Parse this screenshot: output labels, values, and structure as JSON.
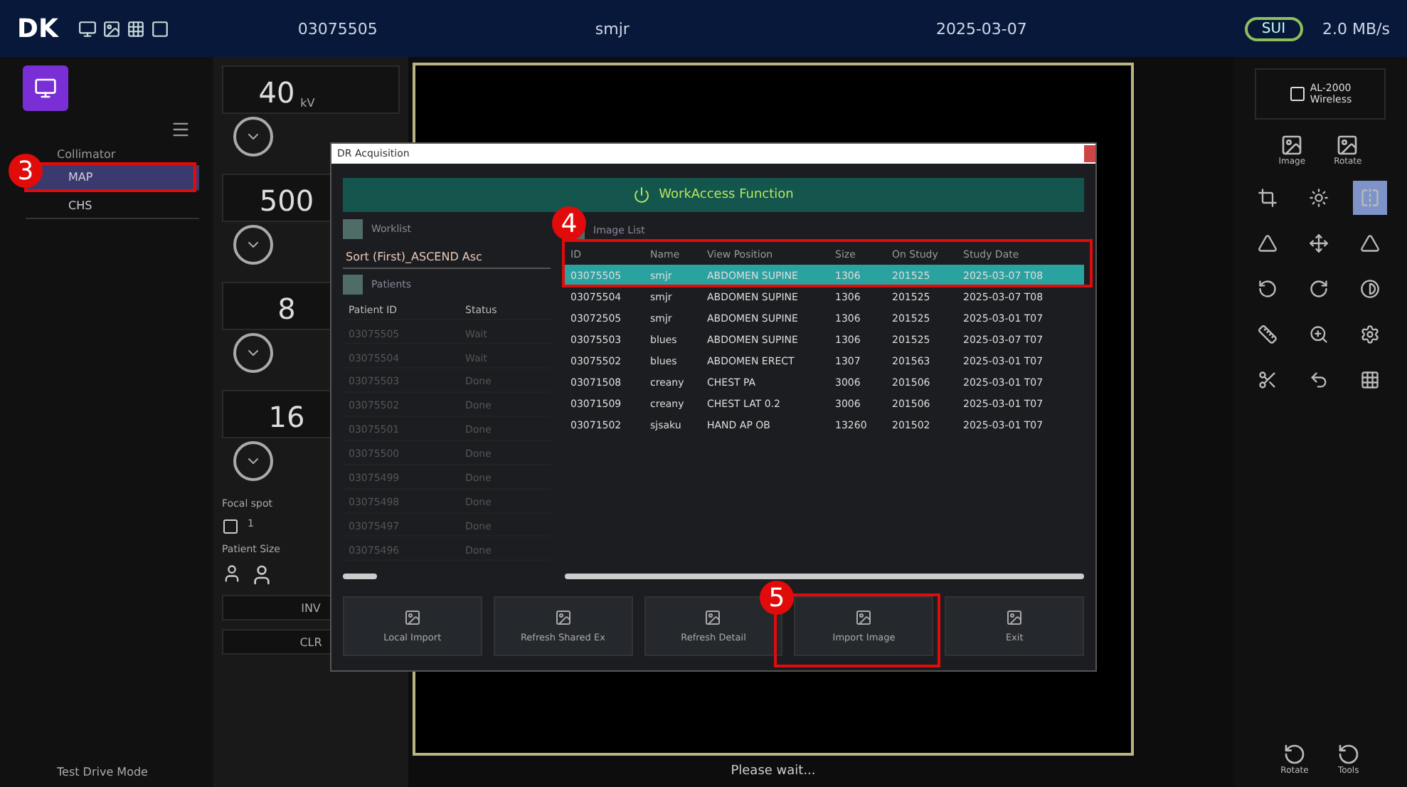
{
  "header": {
    "logo": "DK",
    "patient_id": "03075505",
    "patient_name": "smjr",
    "study_date": "2025-03-07",
    "mode_badge": "SUI",
    "status": "2.0 MB/s"
  },
  "sidebar": {
    "section_label": "Collimator",
    "items": [
      {
        "label": "MAP",
        "selected": true
      },
      {
        "label": "CHS",
        "selected": false
      }
    ],
    "footer": "Test Drive Mode"
  },
  "parameters": [
    {
      "value": "40",
      "unit": "kV"
    },
    {
      "value": "500"
    },
    {
      "value": "8"
    },
    {
      "value": "16"
    }
  ],
  "focal_spot": {
    "label": "Focal spot",
    "value": "1"
  },
  "patient_size": {
    "label": "Patient Size"
  },
  "lower_fields": [
    "INV",
    "CLR"
  ],
  "dialog": {
    "title": "DR Acquisition",
    "banner": "WorkAccess Function",
    "sort_label": "Worklist",
    "sort_value": "Sort (First)_ASCEND Asc",
    "patients_label": "Patients",
    "patient_columns": [
      "Patient ID",
      "Status"
    ],
    "patients": [
      {
        "id": "03075505",
        "status": "Wait"
      },
      {
        "id": "03075504",
        "status": "Wait"
      },
      {
        "id": "03075503",
        "status": "Done"
      },
      {
        "id": "03075502",
        "status": "Done"
      },
      {
        "id": "03075501",
        "status": "Done"
      },
      {
        "id": "03075500",
        "status": "Done"
      },
      {
        "id": "03075499",
        "status": "Done"
      },
      {
        "id": "03075498",
        "status": "Done"
      },
      {
        "id": "03075497",
        "status": "Done"
      },
      {
        "id": "03075496",
        "status": "Done"
      }
    ],
    "images_label": "Image List",
    "image_columns": [
      "ID",
      "Name",
      "View Position",
      "Size",
      "On Study",
      "Study Date"
    ],
    "images": [
      {
        "cells": [
          "03075505",
          "smjr",
          "ABDOMEN SUPINE",
          "1306",
          "201525",
          "2025-03-07 T08"
        ],
        "selected": true
      },
      {
        "cells": [
          "03075504",
          "smjr",
          "ABDOMEN SUPINE",
          "1306",
          "201525",
          "2025-03-07 T08"
        ],
        "selected": false
      },
      {
        "cells": [
          "03072505",
          "smjr",
          "ABDOMEN SUPINE",
          "1306",
          "201525",
          "2025-03-01 T07"
        ],
        "selected": false
      },
      {
        "cells": [
          "03075503",
          "blues",
          "ABDOMEN SUPINE",
          "1306",
          "201525",
          "2025-03-07 T07"
        ],
        "selected": false
      },
      {
        "cells": [
          "03075502",
          "blues",
          "ABDOMEN ERECT",
          "1307",
          "201563",
          "2025-03-01 T07"
        ],
        "selected": false
      },
      {
        "cells": [
          "03071508",
          "creany",
          "CHEST PA",
          "3006",
          "201506",
          "2025-03-01 T07"
        ],
        "selected": false
      },
      {
        "cells": [
          "03071509",
          "creany",
          "CHEST LAT 0.2",
          "3006",
          "201506",
          "2025-03-01 T07"
        ],
        "selected": false
      },
      {
        "cells": [
          "03071502",
          "sjsaku",
          "HAND AP OB",
          "13260",
          "201502",
          "2025-03-01 T07"
        ],
        "selected": false
      }
    ],
    "buttons": [
      "Local Import",
      "Refresh Shared Ex",
      "Refresh Detail",
      "Import Image",
      "Exit"
    ]
  },
  "viewer": {
    "status": "Please wait..."
  },
  "right_panel": {
    "detector": "AL-2000",
    "detector_sub": "Wireless",
    "tool_labels": [
      "Image",
      "Rotate"
    ],
    "bottom_labels": [
      "Rotate",
      "Tools"
    ]
  },
  "annotations": [
    {
      "number": "3"
    },
    {
      "number": "4"
    },
    {
      "number": "5"
    }
  ]
}
